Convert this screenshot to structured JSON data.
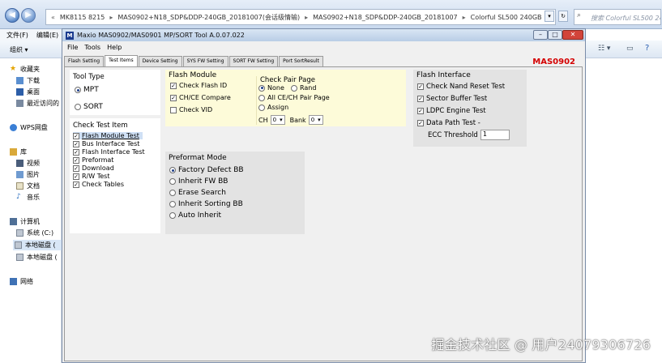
{
  "explorer": {
    "path": [
      "MK8115 8215",
      "MAS0902+N18_SDP&DDP-240GB_20181007(会话级情输)",
      "MAS0902+N18_SDP&DDP-240GB_20181007",
      "Colorful SL500 240GB"
    ],
    "search_placeholder": "搜索 Colorful SL500 240GB",
    "menu": [
      "文件(F)",
      "编辑(E)"
    ],
    "organize": "组织 ▾",
    "sidebar": {
      "favorites": "收藏夹",
      "fav_items": [
        "下载",
        "桌面",
        "最近访问的"
      ],
      "wps": "WPS网盘",
      "library": "库",
      "lib_items": [
        "视频",
        "图片",
        "文档",
        "音乐"
      ],
      "computer": "计算机",
      "comp_items": [
        "系统 (C:)",
        "本地磁盘 (",
        "本地磁盘 ("
      ],
      "network": "网络"
    }
  },
  "tool": {
    "title": "Maxio MAS0902/MAS0901 MP/SORT Tool A.0.07.022",
    "logo": "M",
    "menu": [
      "File",
      "Tools",
      "Help"
    ],
    "tabs": [
      "Flash Setting",
      "Test Items",
      "Device Setting",
      "SYS FW Setting",
      "SORT FW Setting",
      "Port SortResult"
    ],
    "active_tab": "Test Items",
    "badge": "MAS0902",
    "tool_type": {
      "title": "Tool Type",
      "options": [
        {
          "label": "MPT",
          "checked": true
        },
        {
          "label": "SORT",
          "checked": false
        }
      ]
    },
    "check_test_item": {
      "title": "Check Test Item",
      "items": [
        {
          "label": "Flash Module Test",
          "checked": true,
          "selected": true
        },
        {
          "label": "Bus Interface Test",
          "checked": true
        },
        {
          "label": "Flash Interface Test",
          "checked": true
        },
        {
          "label": "Preformat",
          "checked": true
        },
        {
          "label": "Download",
          "checked": true
        },
        {
          "label": "R/W Test",
          "checked": true
        },
        {
          "label": "Check Tables",
          "checked": true
        }
      ]
    },
    "flash_module": {
      "title": "Flash Module",
      "items": [
        {
          "label": "Check Flash ID",
          "checked": true
        },
        {
          "label": "CH/CE Compare",
          "checked": true
        },
        {
          "label": "Check VID",
          "checked": false
        }
      ]
    },
    "check_pair_page": {
      "title": "Check Pair Page",
      "options": [
        {
          "label": "None",
          "checked": true
        },
        {
          "label": "Rand",
          "checked": false
        },
        {
          "label": "All CE/CH Pair Page",
          "checked": false
        },
        {
          "label": "Assign",
          "checked": false
        }
      ],
      "ch_label": "CH",
      "ch_value": "0",
      "bank_label": "Bank",
      "bank_value": "0"
    },
    "flash_interface": {
      "title": "Flash Interface",
      "items": [
        {
          "label": "Check Nand Reset Test",
          "checked": true
        },
        {
          "label": "Sector Buffer Test",
          "checked": true
        },
        {
          "label": "LDPC Engine Test",
          "checked": true
        },
        {
          "label": "Data Path Test -",
          "checked": true
        }
      ],
      "ecc_label": "ECC Threshold",
      "ecc_value": "1"
    },
    "preformat_mode": {
      "title": "Preformat Mode",
      "options": [
        {
          "label": "Factory Defect BB",
          "checked": true
        },
        {
          "label": "Inherit FW BB",
          "checked": false
        },
        {
          "label": "Erase Search",
          "checked": false
        },
        {
          "label": "Inherit Sorting BB",
          "checked": false
        },
        {
          "label": "Auto Inherit",
          "checked": false
        }
      ]
    }
  },
  "watermark": "掘金技术社区 @ 用户24079306726"
}
